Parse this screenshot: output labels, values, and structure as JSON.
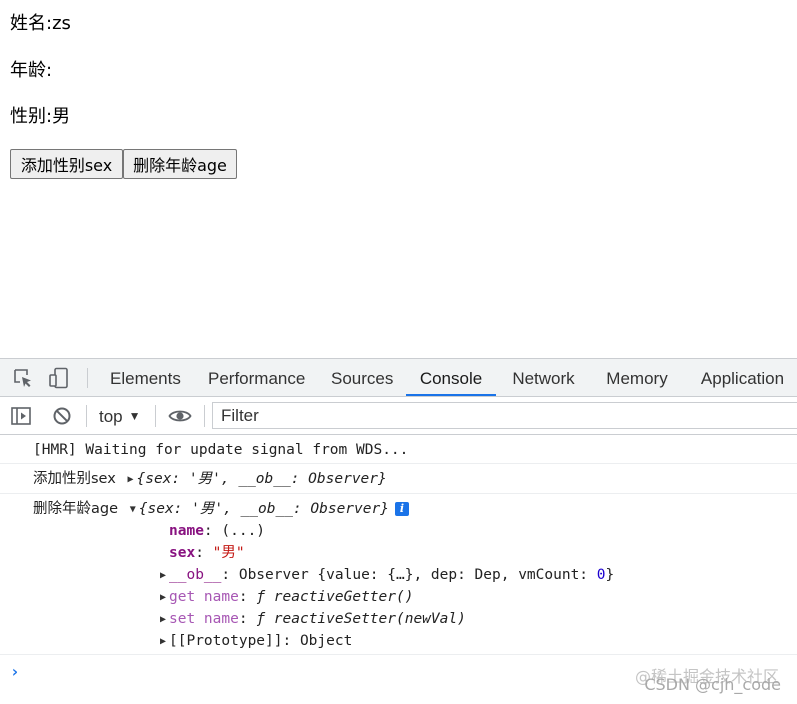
{
  "app": {
    "name_label": "姓名:zs",
    "age_label": "年龄:",
    "sex_label": "性别:男",
    "add_sex_button": "添加性别sex",
    "delete_age_button": "删除年龄age"
  },
  "devtools": {
    "tabs": [
      {
        "label": "Elements"
      },
      {
        "label": "Performance"
      },
      {
        "label": "Sources"
      },
      {
        "label": "Console",
        "active": true
      },
      {
        "label": "Network"
      },
      {
        "label": "Memory"
      },
      {
        "label": "Application"
      }
    ],
    "context": "top",
    "filter_placeholder": "Filter",
    "accent_color": "#1a73e8",
    "messages": {
      "hmr": "[HMR] Waiting for update signal from WDS...",
      "log1_label": "添加性别sex",
      "log1_object": "{sex: '男', __ob__: Observer}",
      "log2_label": "删除年龄age",
      "log2_object": "{sex: '男', __ob__: Observer}",
      "prop_name_key": "name",
      "prop_name_value": ": (...)",
      "prop_sex_key": "sex",
      "prop_sex_value": "\"男\"",
      "prop_ob_key": "__ob__",
      "prop_ob_value": ": Observer {value: {…}, dep: Dep, vmCount: ",
      "prop_ob_vmcount": "0",
      "prop_ob_close": "}",
      "prop_get_key": "get name",
      "prop_get_value": "ƒ reactiveGetter()",
      "prop_set_key": "set name",
      "prop_set_value": "ƒ reactiveSetter(newVal)",
      "prop_proto": "[[Prototype]]: Object"
    },
    "prompt_symbol": "›"
  },
  "watermark": {
    "line1": "@稀土掘金技术社区",
    "line2": "CSDN @cjh_code"
  }
}
